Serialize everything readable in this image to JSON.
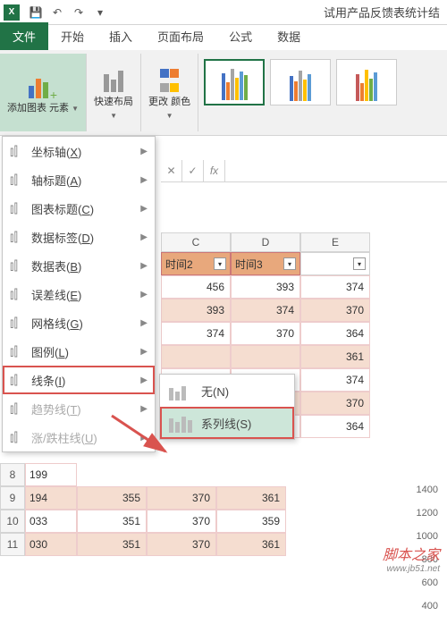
{
  "titlebar": {
    "app": "X",
    "filename": "试用产品反馈表统计结"
  },
  "tabs": {
    "file": "文件",
    "home": "开始",
    "insert": "插入",
    "layout": "页面布局",
    "formula": "公式",
    "data": "数据"
  },
  "ribbon": {
    "addChart": "添加图表\n元素",
    "quickLayout": "快速布局",
    "changeColor": "更改\n颜色"
  },
  "formulaBar": {
    "fx": "fx"
  },
  "menu": {
    "items": [
      {
        "label": "坐标轴(X)",
        "key": "axis"
      },
      {
        "label": "轴标题(A)",
        "key": "axisTitle"
      },
      {
        "label": "图表标题(C)",
        "key": "chartTitle"
      },
      {
        "label": "数据标签(D)",
        "key": "dataLabel"
      },
      {
        "label": "数据表(B)",
        "key": "dataTable"
      },
      {
        "label": "误差线(E)",
        "key": "errorBar"
      },
      {
        "label": "网格线(G)",
        "key": "gridline"
      },
      {
        "label": "图例(L)",
        "key": "legend"
      },
      {
        "label": "线条(I)",
        "key": "lines",
        "highlight": true
      },
      {
        "label": "趋势线(T)",
        "key": "trendline",
        "disabled": true
      },
      {
        "label": "涨/跌柱线(U)",
        "key": "updown",
        "disabled": true
      }
    ]
  },
  "submenu": {
    "none": "无(N)",
    "series": "系列线(S)"
  },
  "columns": [
    "C",
    "D",
    "E"
  ],
  "headers": [
    "时间2",
    "时间3"
  ],
  "data": {
    "rows": [
      {
        "c": "456",
        "d": "393",
        "e": "374"
      },
      {
        "c": "393",
        "d": "374",
        "e": "370"
      },
      {
        "c": "374",
        "d": "370",
        "e": "364"
      },
      {
        "c": "",
        "d": "",
        "e": "361"
      },
      {
        "c": "",
        "d": "",
        "e": "374"
      },
      {
        "c": "",
        "d": "",
        "e": "370"
      },
      {
        "c": "",
        "d": "",
        "e": "364"
      }
    ],
    "leftRows": [
      {
        "n": "8",
        "a": "199"
      },
      {
        "n": "9",
        "a": "194",
        "b": "355",
        "c": "370",
        "d": "361"
      },
      {
        "n": "10",
        "a": "033",
        "b": "351",
        "c": "370",
        "d": "359"
      },
      {
        "n": "11",
        "a": "030",
        "b": "351",
        "c": "370",
        "d": "361"
      }
    ]
  },
  "axis": [
    "1400",
    "1200",
    "1000",
    "800",
    "600",
    "400"
  ],
  "watermark": {
    "text": "脚本之家",
    "url": "www.jb51.net"
  }
}
